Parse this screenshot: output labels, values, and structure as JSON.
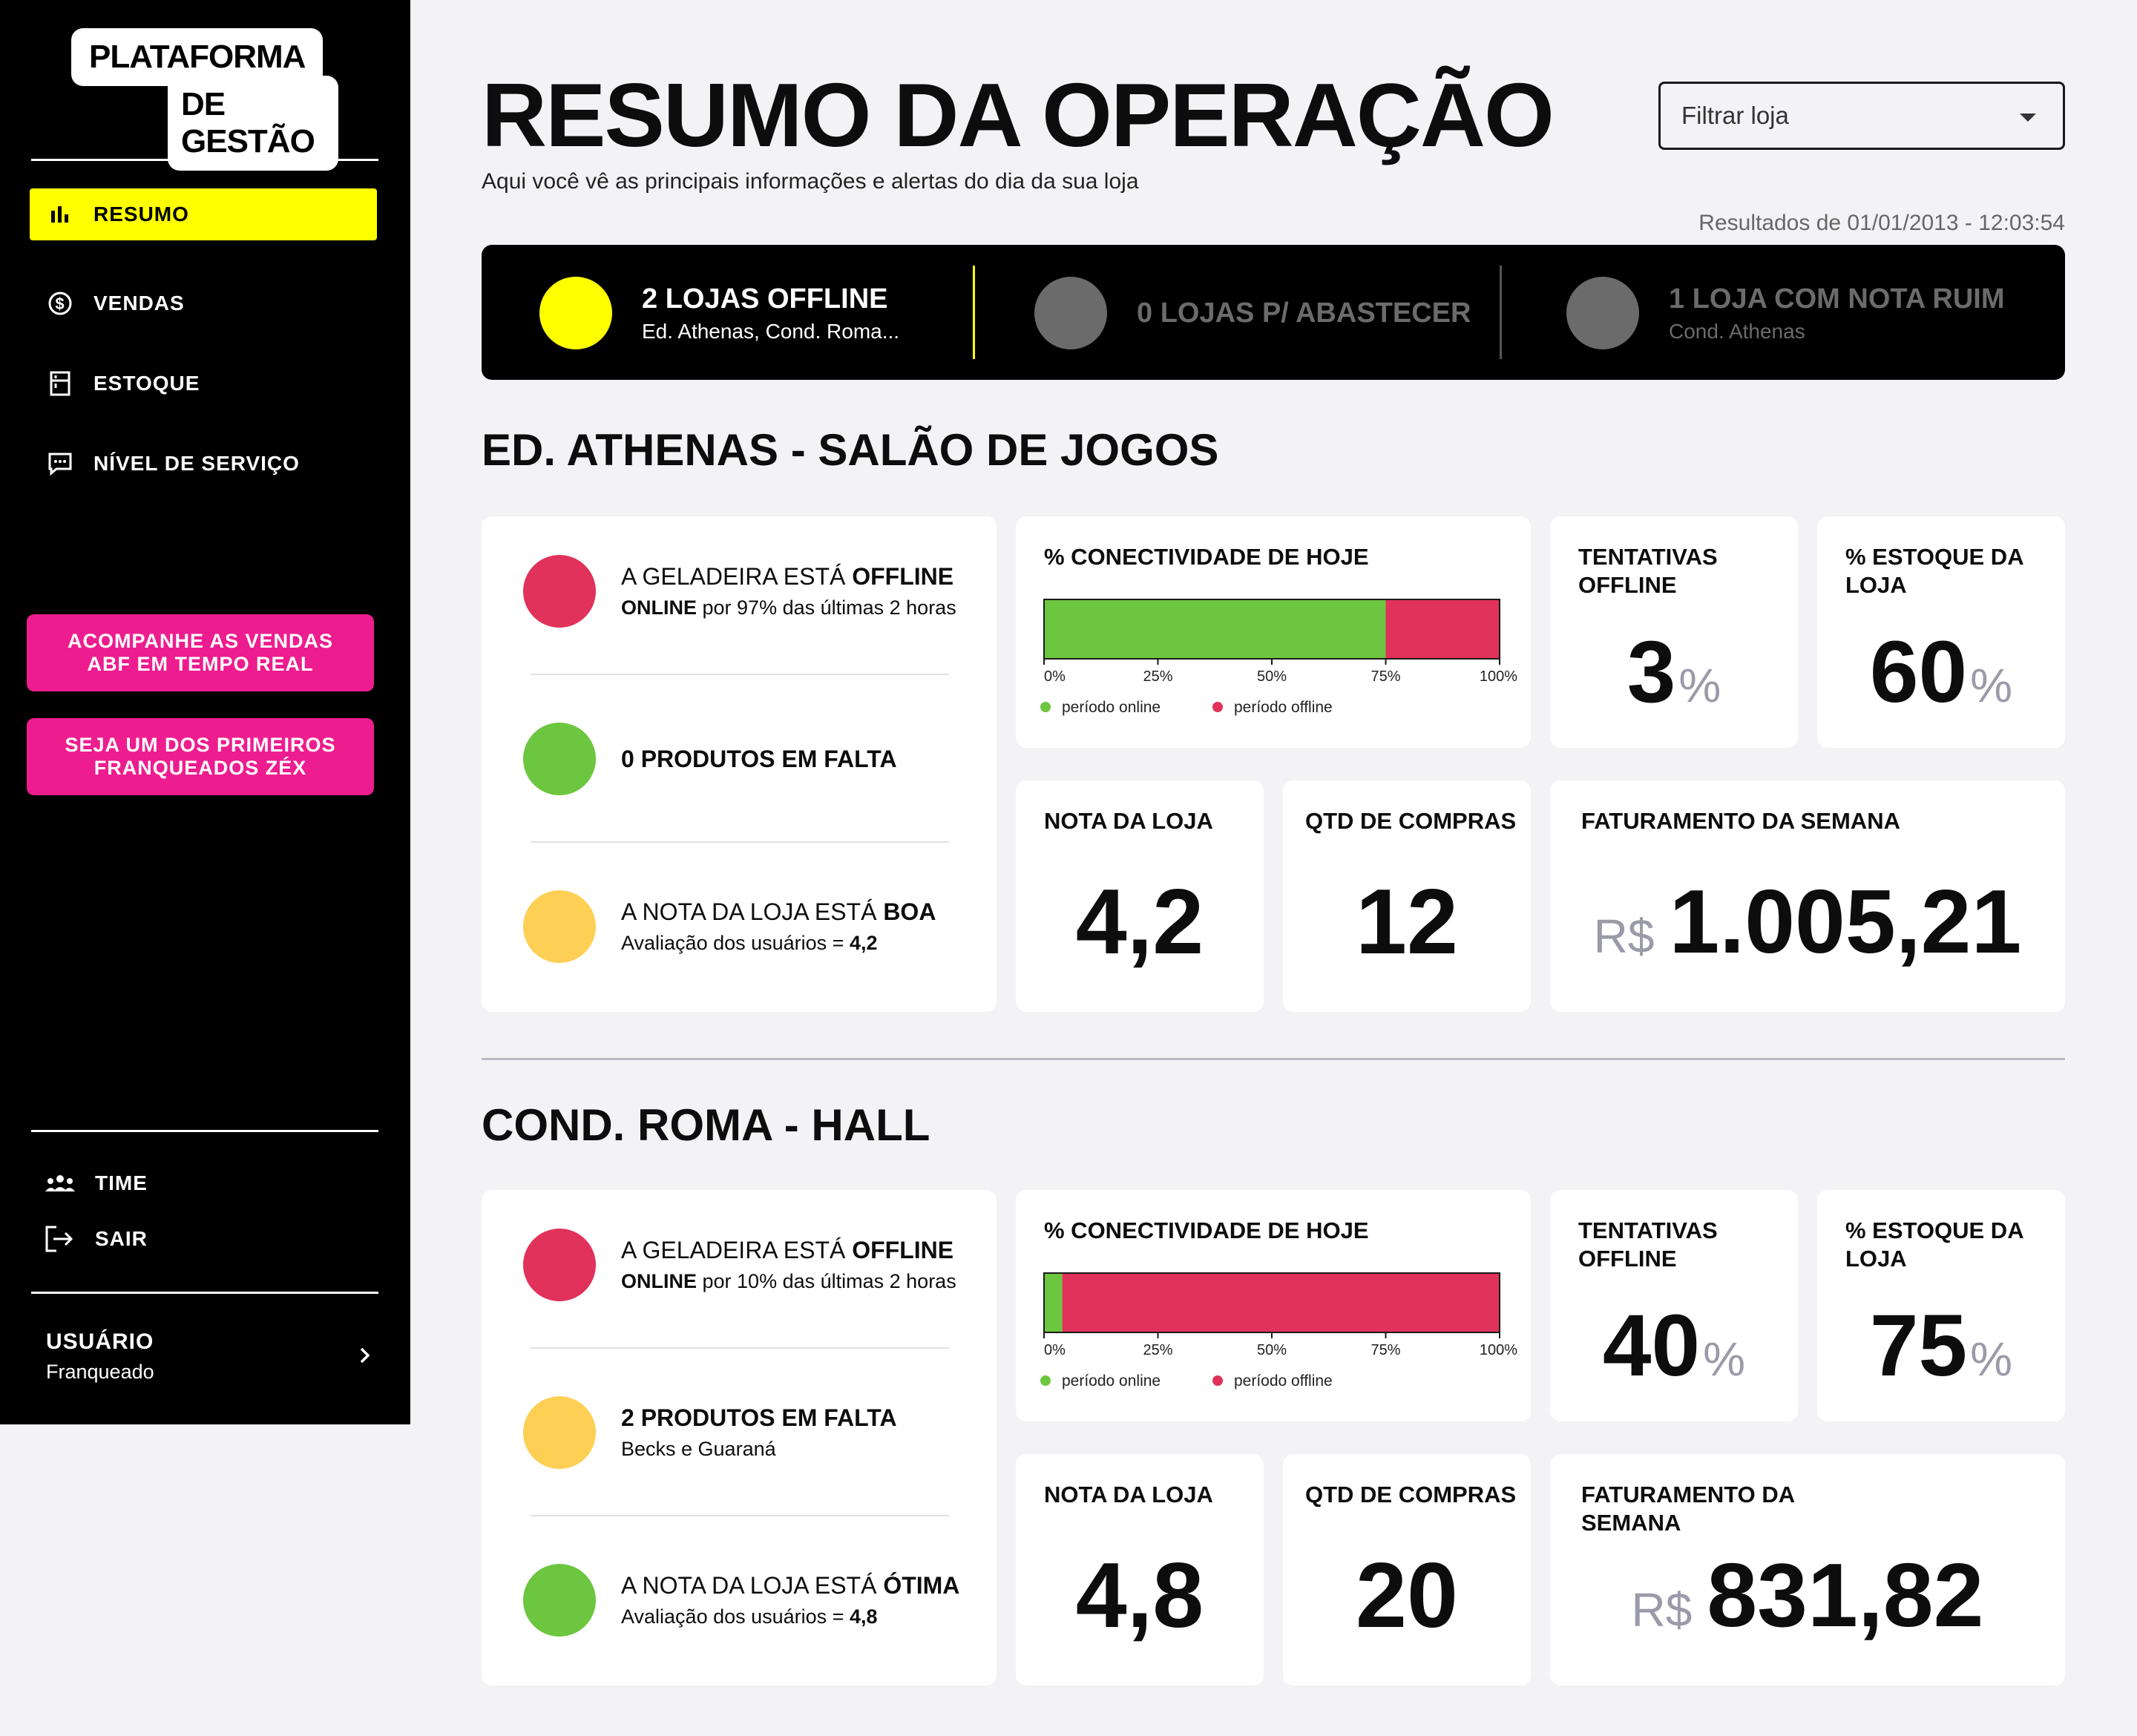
{
  "sidebar": {
    "logo_line1": "PLATAFORMA",
    "logo_line2": "DE GESTÃO",
    "nav": [
      {
        "label": "RESUMO",
        "icon": "bar-chart-icon",
        "active": true
      },
      {
        "label": "VENDAS",
        "icon": "dollar-icon",
        "active": false
      },
      {
        "label": "ESTOQUE",
        "icon": "fridge-icon",
        "active": false
      },
      {
        "label": "NÍVEL DE SERVIÇO",
        "icon": "chat-icon",
        "active": false
      }
    ],
    "promos": [
      "ACOMPANHE AS VENDAS ABF EM TEMPO REAL",
      "SEJA UM DOS PRIMEIROS FRANQUEADOS ZÉX"
    ],
    "footer": [
      {
        "label": "TIME",
        "icon": "team-icon"
      },
      {
        "label": "SAIR",
        "icon": "logout-icon"
      }
    ],
    "user": {
      "title": "USUÁRIO",
      "role": "Franqueado"
    }
  },
  "header": {
    "title": "RESUMO DA OPERAÇÃO",
    "subtitle": "Aqui você vê as principais informações e alertas do dia da sua loja",
    "filter_placeholder": "Filtrar loja",
    "results_date": "Resultados de 01/01/2013 - 12:03:54"
  },
  "alerts": [
    {
      "title": "2 LOJAS OFFLINE",
      "detail": "Ed. Athenas, Cond. Roma...",
      "color": "#ffff00",
      "active": true
    },
    {
      "title": "0 LOJAS P/ ABASTECER",
      "detail": "",
      "color": "#6b6b6b",
      "active": false
    },
    {
      "title": "1 LOJA COM NOTA RUIM",
      "detail": "Cond. Athenas",
      "color": "#6b6b6b",
      "active": false
    }
  ],
  "colors": {
    "red": "#e0325a",
    "green": "#6cc63f",
    "yellow": "#fdd055",
    "pink": "#ee1d8f",
    "accent": "#ffff00"
  },
  "labels": {
    "connectivity": "% CONECTIVIDADE DE HOJE",
    "attempts": "TENTATIVAS OFFLINE",
    "stock": "% ESTOQUE DA LOJA",
    "rating": "NOTA DA LOJA",
    "purchases": "QTD DE COMPRAS",
    "revenue": "FATURAMENTO DA SEMANA",
    "percent": "%",
    "currency": "R$",
    "legend_online": "período online",
    "legend_offline": "período offline",
    "ticks": [
      "0%",
      "25%",
      "50%",
      "75%",
      "100%"
    ]
  },
  "stores": [
    {
      "name": "ED. ATHENAS - SALÃO DE JOGOS",
      "statuses": [
        {
          "line1_pre": "A GELADEIRA ESTÁ ",
          "line1_bold": "OFFLINE",
          "line2_bold": "ONLINE",
          "line2_rest": " por 97% das últimas 2 horas",
          "color": "#e0325a"
        },
        {
          "line1_pre": "",
          "line1_bold": "0 PRODUTOS EM FALTA",
          "line2_bold": "",
          "line2_rest": "",
          "color": "#6cc63f"
        },
        {
          "line1_pre": "A NOTA DA LOJA ESTÁ ",
          "line1_bold": "BOA",
          "line2_bold": "",
          "line2_rest": "Avaliação dos usuários = ",
          "line2_tail": "4,2",
          "color": "#fdd055"
        }
      ],
      "attempts_value": "3",
      "stock_value": "60",
      "rating_value": "4,2",
      "purchases_value": "12",
      "revenue_value": "1.005,21"
    },
    {
      "name": "COND. ROMA - HALL",
      "statuses": [
        {
          "line1_pre": "A GELADEIRA ESTÁ ",
          "line1_bold": "OFFLINE",
          "line2_bold": "ONLINE",
          "line2_rest": " por 10% das últimas 2 horas",
          "color": "#e0325a"
        },
        {
          "line1_pre": "",
          "line1_bold": "2 PRODUTOS EM FALTA",
          "line2_bold": "",
          "line2_rest": "Becks e Guaraná",
          "color": "#fdd055"
        },
        {
          "line1_pre": "A NOTA DA LOJA ESTÁ ",
          "line1_bold": "ÓTIMA",
          "line2_bold": "",
          "line2_rest": "Avaliação dos usuários = ",
          "line2_tail": "4,8",
          "color": "#6cc63f"
        }
      ],
      "attempts_value": "40",
      "stock_value": "75",
      "rating_value": "4,8",
      "purchases_value": "20",
      "revenue_value": "831,82"
    }
  ],
  "chart_data": [
    {
      "type": "bar",
      "title": "% CONECTIVIDADE DE HOJE",
      "stacked": true,
      "orientation": "horizontal",
      "xlim": [
        0,
        100
      ],
      "ticks": [
        "0%",
        "25%",
        "50%",
        "75%",
        "100%"
      ],
      "series": [
        {
          "name": "período online",
          "values": [
            75
          ]
        },
        {
          "name": "período offline",
          "values": [
            25
          ]
        }
      ],
      "legend": "bottom-left"
    },
    {
      "type": "bar",
      "title": "% CONECTIVIDADE DE HOJE",
      "stacked": true,
      "orientation": "horizontal",
      "xlim": [
        0,
        100
      ],
      "ticks": [
        "0%",
        "25%",
        "50%",
        "75%",
        "100%"
      ],
      "series": [
        {
          "name": "período online",
          "values": [
            4
          ]
        },
        {
          "name": "período offline",
          "values": [
            96
          ]
        }
      ],
      "legend": "bottom-left"
    }
  ]
}
